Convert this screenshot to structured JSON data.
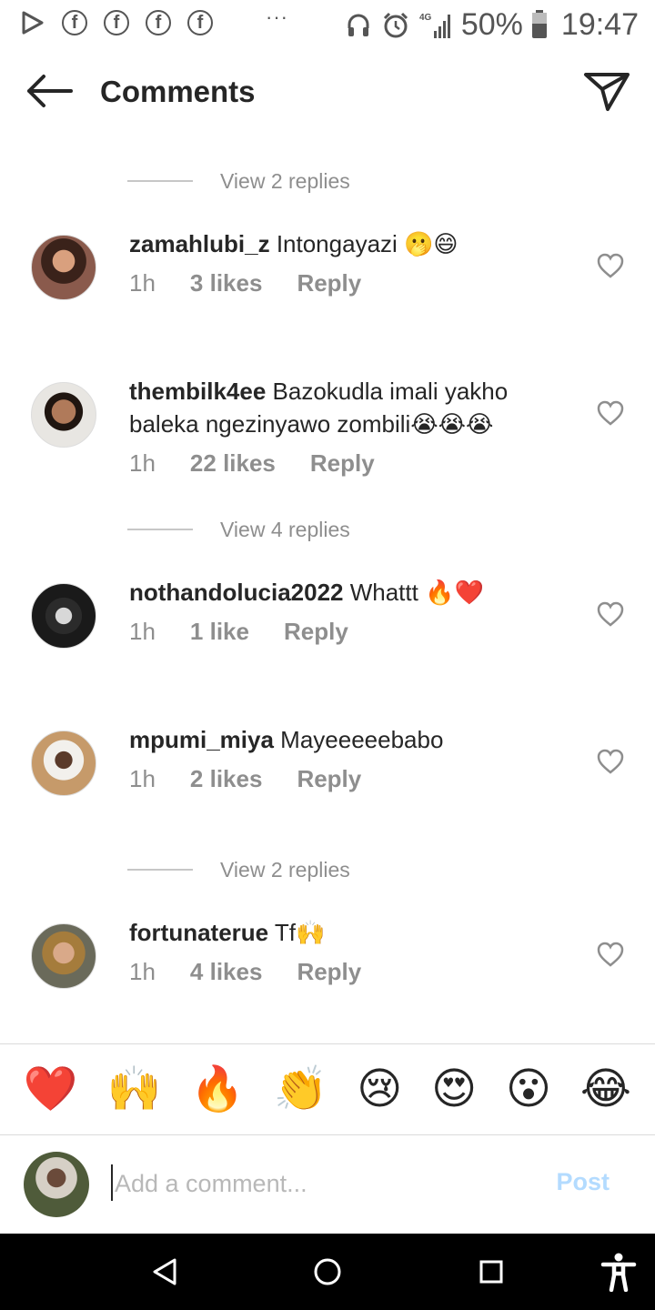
{
  "status_bar": {
    "battery": "50%",
    "time": "19:47",
    "network": "4G",
    "facebook_glyph": "f",
    "overflow_dots": "···"
  },
  "header": {
    "title": "Comments"
  },
  "view_replies": [
    {
      "label": "View 2 replies"
    },
    {
      "label": "View 4 replies"
    },
    {
      "label": "View 2 replies"
    }
  ],
  "comments": [
    {
      "username": "zamahlubi_z",
      "text": " Intongayazi 🫢😄",
      "time": "1h",
      "likes": "3 likes",
      "reply": "Reply"
    },
    {
      "username": "thembilk4ee",
      "text": " Bazokudla imali yakho baleka ngezinyawo zombili😭😭😭",
      "time": "1h",
      "likes": "22 likes",
      "reply": "Reply"
    },
    {
      "username": "nothandolucia2022",
      "text": " Whattt 🔥❤️",
      "time": "1h",
      "likes": "1 like",
      "reply": "Reply"
    },
    {
      "username": "mpumi_miya",
      "text": " Mayeeeeebabo",
      "time": "1h",
      "likes": "2 likes",
      "reply": "Reply"
    },
    {
      "username": "fortunaterue",
      "text": " Tf🙌",
      "time": "1h",
      "likes": "4 likes",
      "reply": "Reply"
    }
  ],
  "quick_reactions": [
    "❤️",
    "🙌",
    "🔥",
    "👏",
    "😢",
    "😍",
    "😮",
    "😂"
  ],
  "input": {
    "placeholder": "Add a comment...",
    "value": "",
    "post_label": "Post"
  },
  "colors": {
    "text": "#262626",
    "secondary": "#8e8e8e",
    "post_disabled": "#b3dbff",
    "navbar": "#000000"
  }
}
